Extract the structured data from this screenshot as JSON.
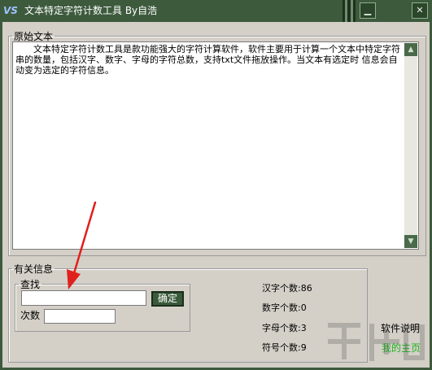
{
  "window": {
    "title": "文本特定字符计数工具 By自浩",
    "icon_text": "VS",
    "minimize_icon": "minimize-icon",
    "close_icon": "close-icon"
  },
  "original_text": {
    "legend": "原始文本",
    "content": "文本特定字符计数工具是款功能强大的字符计算软件，软件主要用于计算一个文本中特定字符串的数量，包括汉字、数字、字母的字符总数，支持txt文件拖放操作。当文本有选定时 信息会自动变为选定的字符信息。"
  },
  "info": {
    "legend": "有关信息",
    "search": {
      "legend": "查找",
      "input_value": "",
      "confirm_label": "确定",
      "count_label": "次数",
      "count_value": ""
    },
    "stats": {
      "hanzi": "汉字个数:86",
      "digits": "数字个数:0",
      "letters": "字母个数:3",
      "symbols": "符号个数:9"
    },
    "links": {
      "help": "软件说明",
      "homepage": "我的主页"
    }
  },
  "colors": {
    "titlebar": "#3d5a3d",
    "link_green": "#1db31d",
    "window_bg": "#d4d0c8"
  }
}
